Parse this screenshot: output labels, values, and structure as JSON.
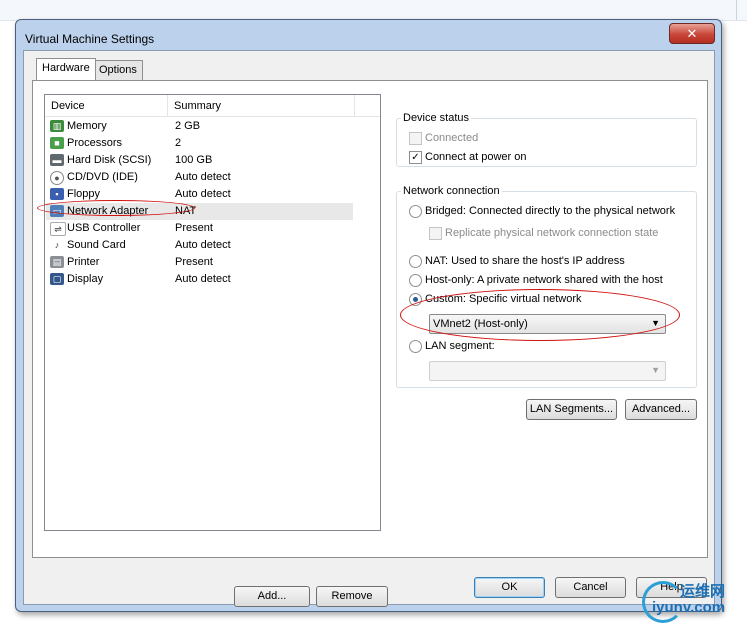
{
  "window": {
    "title": "Virtual Machine Settings",
    "close_glyph": "✕"
  },
  "tabs": [
    {
      "label": "Hardware"
    },
    {
      "label": "Options"
    }
  ],
  "device_list": {
    "columns": {
      "device": "Device",
      "summary": "Summary"
    },
    "rows": [
      {
        "icon": "memory-icon",
        "device": "Memory",
        "summary": "2 GB"
      },
      {
        "icon": "processor-icon",
        "device": "Processors",
        "summary": "2"
      },
      {
        "icon": "hard-disk-icon",
        "device": "Hard Disk (SCSI)",
        "summary": "100 GB"
      },
      {
        "icon": "cd-dvd-icon",
        "device": "CD/DVD (IDE)",
        "summary": "Auto detect"
      },
      {
        "icon": "floppy-icon",
        "device": "Floppy",
        "summary": "Auto detect"
      },
      {
        "icon": "network-adapter-icon",
        "device": "Network Adapter",
        "summary": "NAT",
        "selected": true
      },
      {
        "icon": "usb-icon",
        "device": "USB Controller",
        "summary": "Present"
      },
      {
        "icon": "sound-card-icon",
        "device": "Sound Card",
        "summary": "Auto detect"
      },
      {
        "icon": "printer-icon",
        "device": "Printer",
        "summary": "Present"
      },
      {
        "icon": "display-icon",
        "device": "Display",
        "summary": "Auto detect"
      }
    ],
    "add_label": "Add...",
    "remove_label": "Remove"
  },
  "device_status": {
    "title": "Device status",
    "connected": {
      "label": "Connected",
      "checked": false,
      "enabled": false
    },
    "connect_at_power_on": {
      "label": "Connect at power on",
      "checked": true,
      "enabled": true
    }
  },
  "network_connection": {
    "title": "Network connection",
    "bridged": "Bridged: Connected directly to the physical network",
    "replicate": "Replicate physical network connection state",
    "nat": "NAT: Used to share the host's IP address",
    "host_only": "Host-only: A private network shared with the host",
    "custom": "Custom: Specific virtual network",
    "custom_value": "VMnet2 (Host-only)",
    "lan_segment": "LAN segment:",
    "lan_segment_value": "",
    "selected": "custom"
  },
  "buttons": {
    "lan_segments": "LAN Segments...",
    "advanced": "Advanced...",
    "ok": "OK",
    "cancel": "Cancel",
    "help": "Help"
  },
  "watermark": {
    "cn": "运维网",
    "en": "iyunv.com"
  },
  "colors": {
    "annotation": "#d01010",
    "close_button": "#c9473a",
    "frame": "#bcd2ec"
  }
}
